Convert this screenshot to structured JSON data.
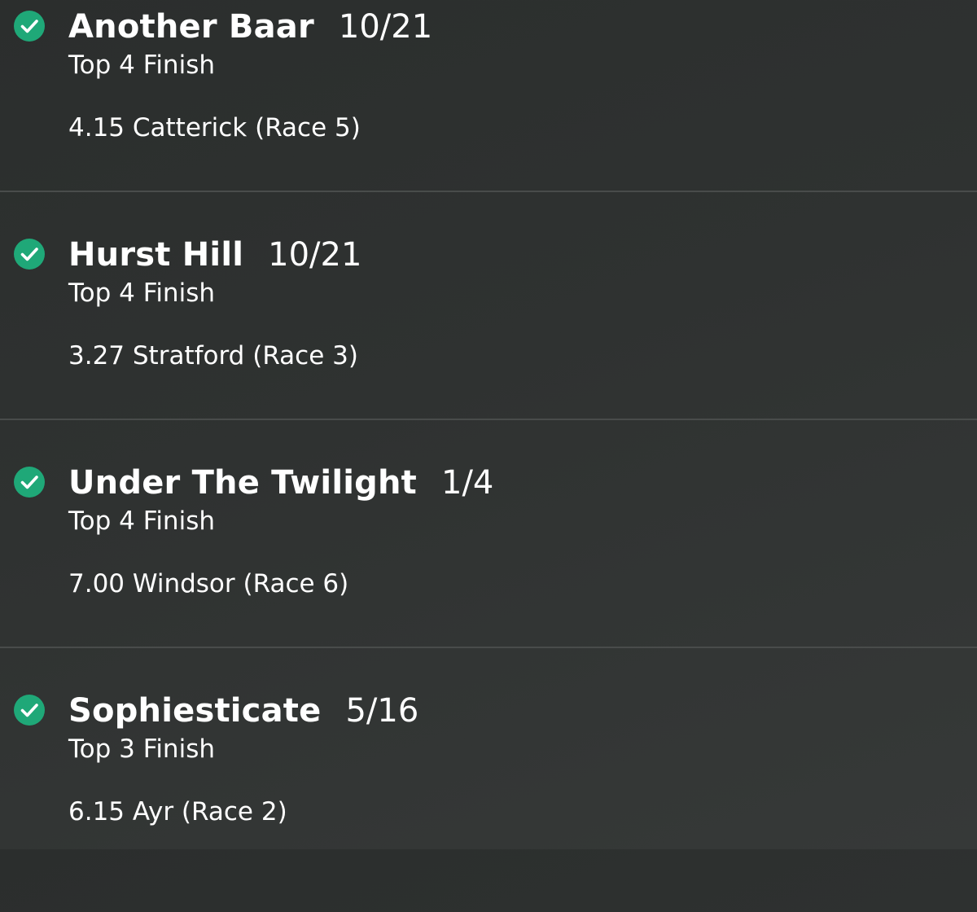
{
  "bets": [
    {
      "status_icon": "check-circle-icon",
      "selection": "Another Baar",
      "odds": "10/21",
      "market": "Top 4 Finish",
      "event": "4.15 Catterick (Race 5)"
    },
    {
      "status_icon": "check-circle-icon",
      "selection": "Hurst Hill",
      "odds": "10/21",
      "market": "Top 4 Finish",
      "event": "3.27 Stratford (Race 3)"
    },
    {
      "status_icon": "check-circle-icon",
      "selection": "Under The Twilight",
      "odds": "1/4",
      "market": "Top 4 Finish",
      "event": "7.00 Windsor (Race 6)"
    },
    {
      "status_icon": "check-circle-icon",
      "selection": "Sophiesticate",
      "odds": "5/16",
      "market": "Top 3 Finish",
      "event": "6.15 Ayr (Race 2)"
    }
  ],
  "colors": {
    "background": "#2f3231",
    "win_green": "#1fa878",
    "divider": "#494c4b",
    "text": "#ffffff"
  }
}
